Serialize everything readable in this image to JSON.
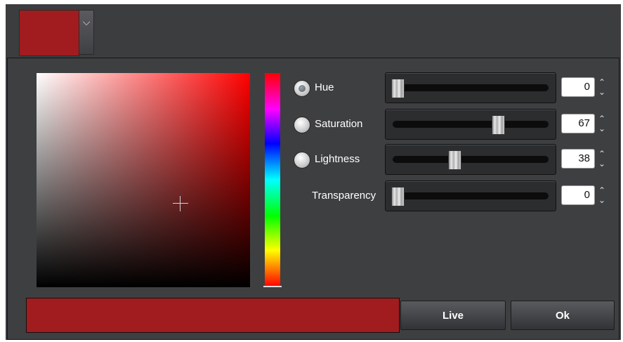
{
  "colors": {
    "current": "#a11c1f",
    "accent": "#a11c1f"
  },
  "header": {
    "dropdown_icon": "chevron-down-icon",
    "dropdown_glyph": "⌵"
  },
  "channels": [
    {
      "label": "Hue",
      "value": "0",
      "level": 0.0,
      "mode_radio": true,
      "selected": true
    },
    {
      "label": "Saturation",
      "value": "67",
      "level": 0.67,
      "mode_radio": true,
      "selected": false
    },
    {
      "label": "Lightness",
      "value": "38",
      "level": 0.38,
      "mode_radio": true,
      "selected": false
    },
    {
      "label": "Transparency",
      "value": "0",
      "level": 0.0,
      "mode_radio": false,
      "selected": false
    }
  ],
  "spinner": {
    "up_glyph": "⌃",
    "down_glyph": "⌄"
  },
  "buttons": {
    "live_label": "Live",
    "ok_label": "Ok"
  }
}
